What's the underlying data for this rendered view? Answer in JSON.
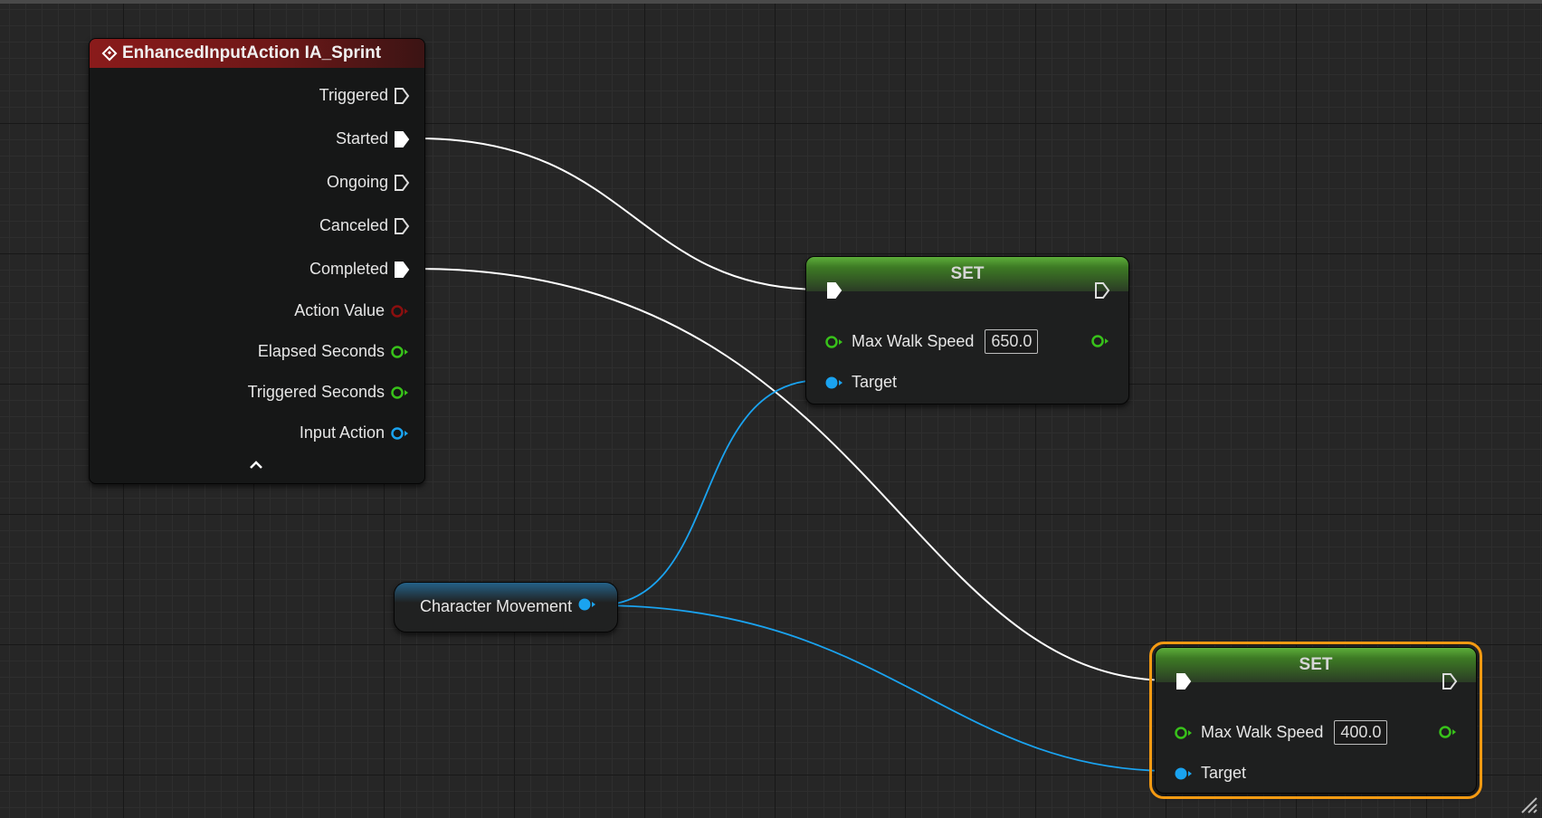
{
  "event_node": {
    "title": "EnhancedInputAction IA_Sprint",
    "header_color": "#8a1b1b",
    "pins": [
      {
        "label": "Triggered",
        "type": "exec",
        "connected": false
      },
      {
        "label": "Started",
        "type": "exec",
        "connected": true
      },
      {
        "label": "Ongoing",
        "type": "exec",
        "connected": false
      },
      {
        "label": "Canceled",
        "type": "exec",
        "connected": false
      },
      {
        "label": "Completed",
        "type": "exec",
        "connected": true
      },
      {
        "label": "Action Value",
        "type": "data",
        "color": "#8b0f0f"
      },
      {
        "label": "Elapsed Seconds",
        "type": "data",
        "color": "#38c21a"
      },
      {
        "label": "Triggered Seconds",
        "type": "data",
        "color": "#38c21a"
      },
      {
        "label": "Input Action",
        "type": "data",
        "color": "#1aa3f0"
      }
    ]
  },
  "set_nodes": [
    {
      "title": "SET",
      "property": "Max Walk Speed",
      "value": "650.0",
      "target_label": "Target",
      "selected": false
    },
    {
      "title": "SET",
      "property": "Max Walk Speed",
      "value": "400.0",
      "target_label": "Target",
      "selected": true
    }
  ],
  "variable_node": {
    "label": "Character Movement",
    "color": "#1aa3f0"
  },
  "colors": {
    "exec_wire": "#ffffff",
    "object_wire": "#1aa3f0",
    "float_pin": "#38c21a",
    "selection": "#f59a12",
    "set_header": "#5dae3a"
  }
}
